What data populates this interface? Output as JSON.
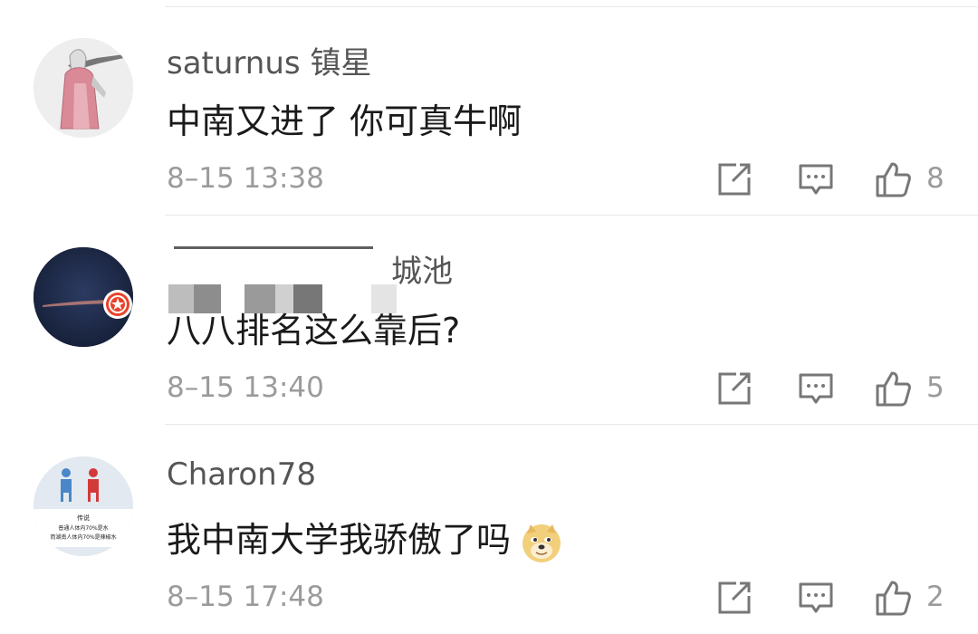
{
  "comments": [
    {
      "username": "saturnus 镇星",
      "text": "中南又进了 你可真牛啊",
      "time": "8–15 13:38",
      "likes": "8"
    },
    {
      "username_visible": "城池",
      "text": "八八排名这么靠后?",
      "time": "8–15 13:40",
      "likes": "5"
    },
    {
      "username": "Charon78",
      "text": "我中南大学我骄傲了吗",
      "time": "8–15 17:48",
      "likes": "2",
      "avatar_text": {
        "line1": "传说",
        "line2": "普通人体内70%是水",
        "line3": "而湖南人体内70%是辣椒水"
      }
    }
  ],
  "icons": {
    "repost": "repost-icon",
    "reply": "comment-icon",
    "like": "thumbs-up-icon",
    "emoji": "doge-emoji-icon",
    "badge": "verified-star-badge-icon"
  },
  "colors": {
    "username": "#555555",
    "meta": "#9b9b9b",
    "badge": "#e8432a"
  }
}
